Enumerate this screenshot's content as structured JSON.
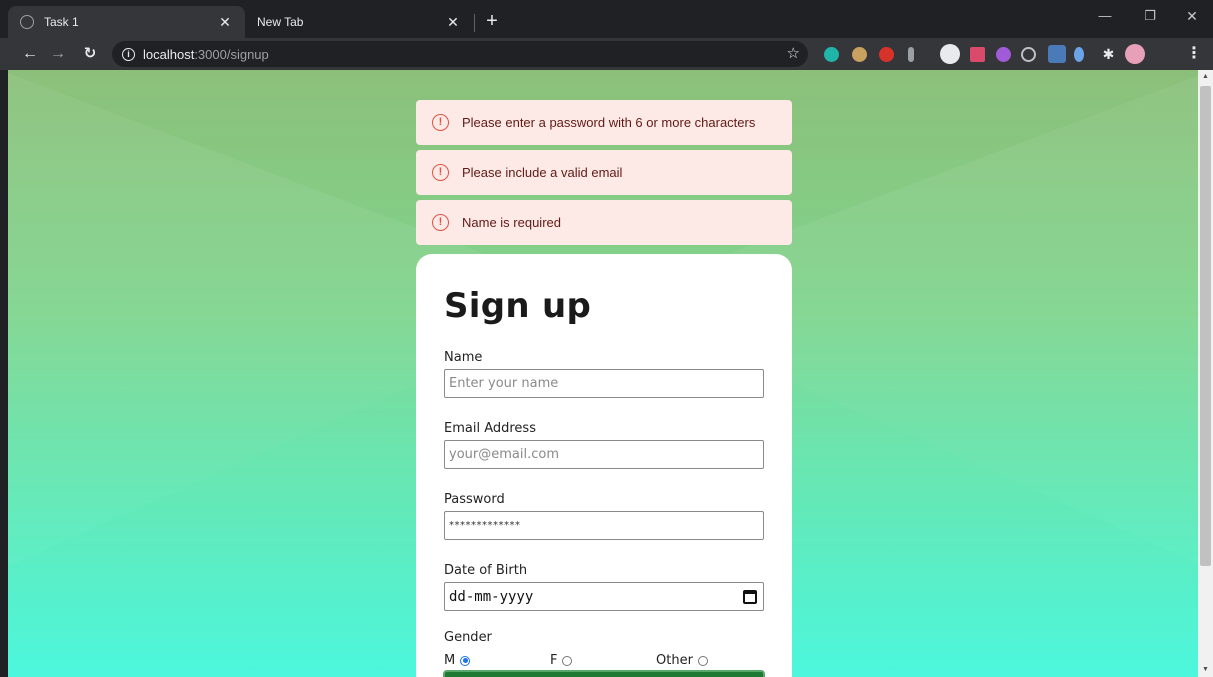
{
  "browser": {
    "tabs": [
      {
        "title": "Task 1",
        "active": true
      },
      {
        "title": "New Tab",
        "active": false
      }
    ],
    "url": {
      "host": "localhost",
      "path": ":3000/signup"
    }
  },
  "alerts": [
    {
      "text": "Please enter a password with 6 or more characters"
    },
    {
      "text": "Please include a valid email"
    },
    {
      "text": "Name is required"
    }
  ],
  "form": {
    "title": "Sign up",
    "name": {
      "label": "Name",
      "placeholder": "Enter your name"
    },
    "email": {
      "label": "Email Address",
      "placeholder": "your@email.com"
    },
    "password": {
      "label": "Password",
      "value": "*************"
    },
    "dob": {
      "label": "Date of Birth",
      "placeholder": "dd-mm-yyyy"
    },
    "gender": {
      "label": "Gender",
      "options": [
        {
          "label": "M",
          "checked": true
        },
        {
          "label": "F",
          "checked": false
        },
        {
          "label": "Other",
          "checked": false
        }
      ]
    }
  },
  "colors": {
    "alert_bg": "#fde9e6",
    "alert_icon": "#e05343",
    "submit": "#1e7a32",
    "radio_checked": "#1a73e8"
  }
}
